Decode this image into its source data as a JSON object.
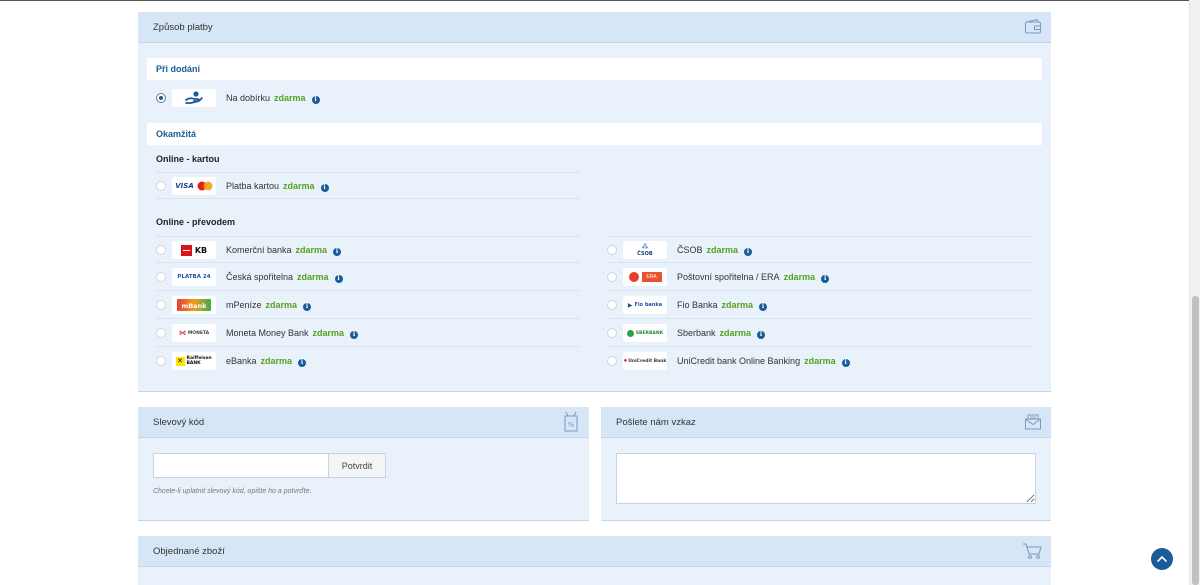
{
  "payment": {
    "title": "Způsob platby",
    "on_delivery": {
      "heading": "Při dodání",
      "items": [
        {
          "label": "Na dobírku",
          "free": "zdarma",
          "icon": "hand-coin-icon",
          "selected": true
        }
      ]
    },
    "instant": {
      "heading": "Okamžitá",
      "card_heading": "Online - kartou",
      "card_items": [
        {
          "label": "Platba kartou",
          "free": "zdarma",
          "logo": "VISA",
          "icon": "visa-mastercard-logo"
        }
      ],
      "transfer_heading": "Online - převodem",
      "transfer_left": [
        {
          "label": "Komerční banka",
          "free": "zdarma",
          "logo": "KB",
          "icon": "kb-logo"
        },
        {
          "label": "Česká spořitelna",
          "free": "zdarma",
          "logo": "PLATBA 24",
          "icon": "platba24-logo"
        },
        {
          "label": "mPeníze",
          "free": "zdarma",
          "logo": "mBank",
          "icon": "mbank-logo"
        },
        {
          "label": "Moneta Money Bank",
          "free": "zdarma",
          "logo": "MONETA",
          "icon": "moneta-logo"
        },
        {
          "label": "eBanka",
          "free": "zdarma",
          "logo": "Raiffeisen BANK",
          "icon": "raiffeisen-logo"
        }
      ],
      "transfer_right": [
        {
          "label": "ČSOB",
          "free": "zdarma",
          "logo": "ČSOB",
          "icon": "csob-logo"
        },
        {
          "label": "Poštovní spořitelna / ERA",
          "free": "zdarma",
          "logo": "ERA",
          "icon": "era-logo"
        },
        {
          "label": "Fio Banka",
          "free": "zdarma",
          "logo": "Fio banka",
          "icon": "fio-logo"
        },
        {
          "label": "Sberbank",
          "free": "zdarma",
          "logo": "SBERBANK",
          "icon": "sberbank-logo"
        },
        {
          "label": "UniCredit bank Online Banking",
          "free": "zdarma",
          "logo": "UniCredit Bank",
          "icon": "unicredit-logo"
        }
      ]
    },
    "header_icon": "wallet-icon"
  },
  "discount": {
    "title": "Slevový kód",
    "input_value": "",
    "button_label": "Potvrdit",
    "hint": "Chcete-li uplatnit slevový kód, opište ho a potvrďte.",
    "header_icon": "discount-tag-icon"
  },
  "message": {
    "title": "Pošlete nám vzkaz",
    "textarea_value": "",
    "header_icon": "mail-icon"
  },
  "order": {
    "title": "Objednané zboží",
    "header_icon": "cart-icon"
  },
  "scroll_top": {
    "icon": "chevron-up-icon"
  },
  "colors": {
    "accent": "#1a5c9a",
    "free_green": "#55a21f",
    "panel_bg": "#e9f1fb",
    "panel_head": "#d6e6f6"
  }
}
